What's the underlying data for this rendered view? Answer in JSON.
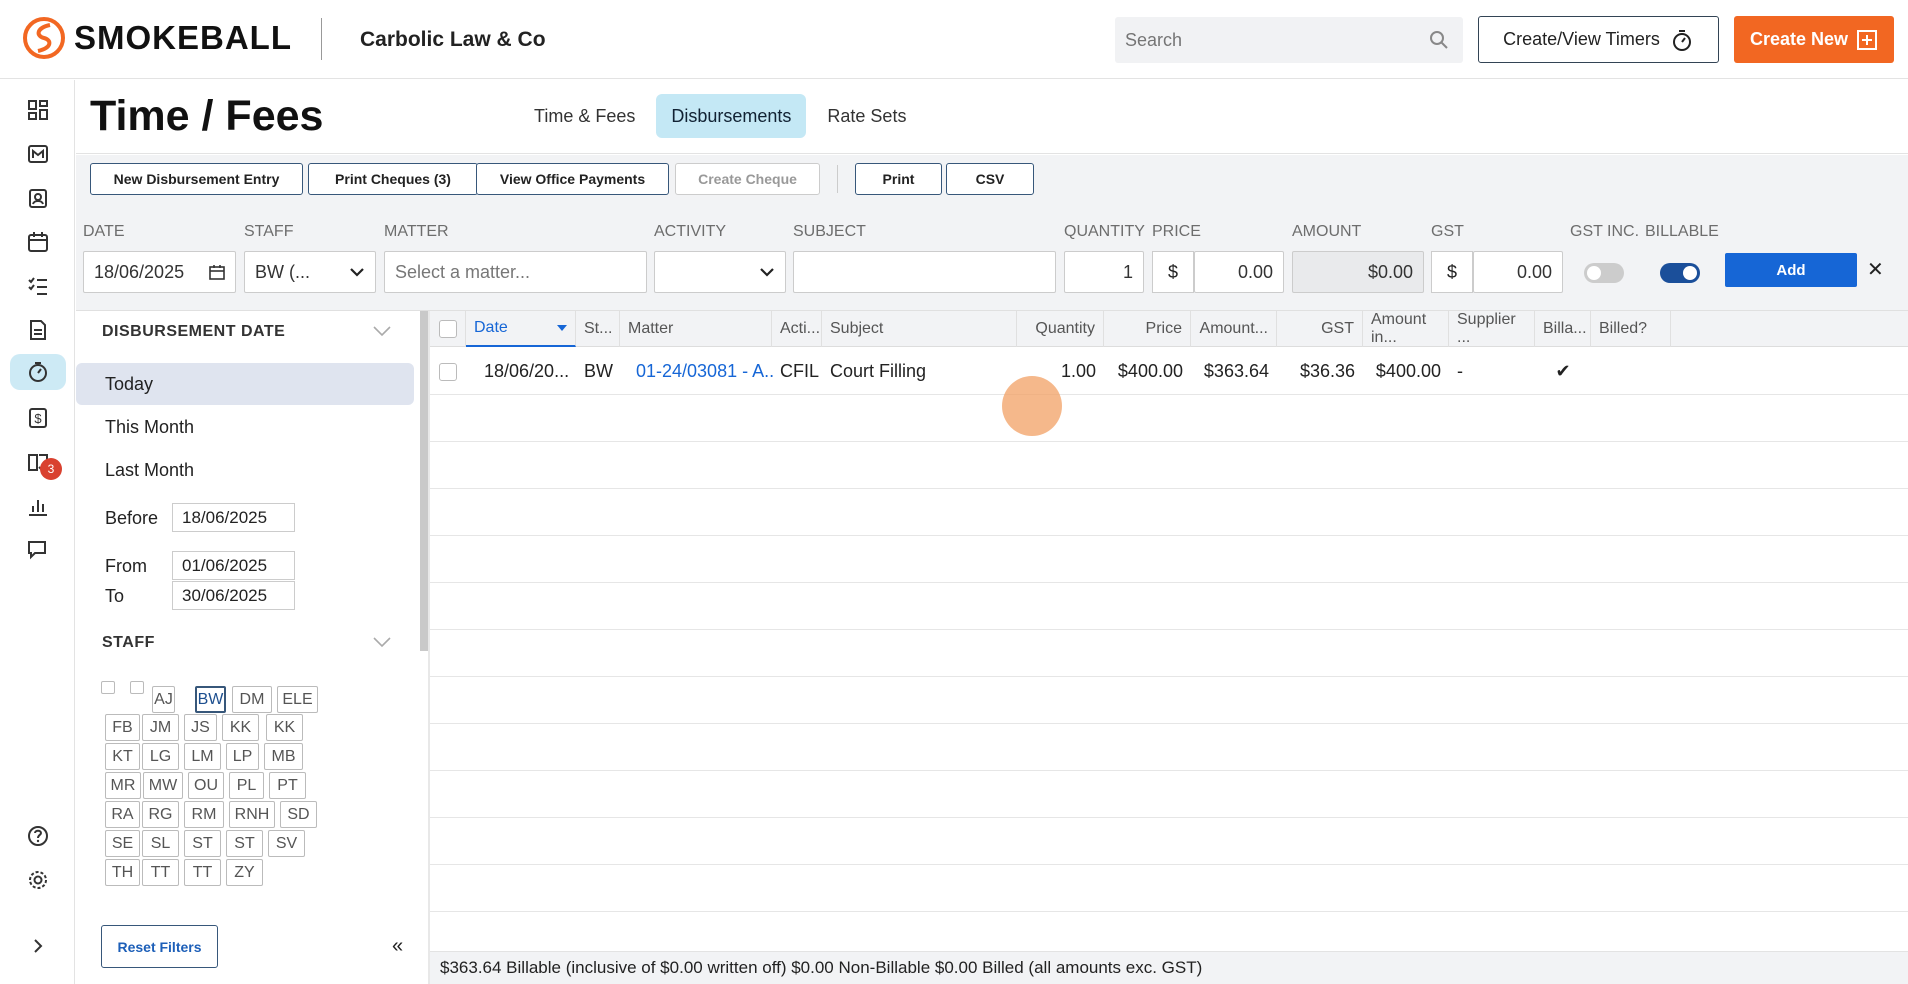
{
  "app": {
    "brand": "SMOKEBALL",
    "firm": "Carbolic Law & Co"
  },
  "header": {
    "search_placeholder": "Search",
    "timers_label": "Create/View Timers",
    "create_label": "Create New"
  },
  "nav": {
    "messages_badge": "3"
  },
  "page": {
    "title": "Time / Fees",
    "tabs": [
      {
        "label": "Time & Fees",
        "active": false
      },
      {
        "label": "Disbursements",
        "active": true
      },
      {
        "label": "Rate Sets",
        "active": false
      }
    ]
  },
  "toolbar": {
    "new_entry": "New Disbursement Entry",
    "print_cheques": "Print Cheques (3)",
    "view_office": "View Office Payments",
    "create_cheque": "Create Cheque",
    "print": "Print",
    "csv": "CSV"
  },
  "entry": {
    "labels": {
      "date": "DATE",
      "staff": "STAFF",
      "matter": "MATTER",
      "activity": "ACTIVITY",
      "subject": "SUBJECT",
      "quantity": "QUANTITY",
      "price": "PRICE",
      "amount": "AMOUNT",
      "gst": "GST",
      "gst_inc": "GST INC.",
      "billable": "BILLABLE"
    },
    "date_value": "18/06/2025",
    "staff_value": "BW (...",
    "matter_placeholder": "Select a matter...",
    "activity_value": "",
    "subject_value": "",
    "quantity_value": "1",
    "currency": "$",
    "price_value": "0.00",
    "amount_value": "$0.00",
    "gst_value": "0.00",
    "gst_inc_on": false,
    "billable_on": true,
    "add_label": "Add",
    "close_glyph": "✕"
  },
  "filters": {
    "date_heading": "DISBURSEMENT DATE",
    "date_items": [
      {
        "label": "Today",
        "active": true
      },
      {
        "label": "This Month",
        "active": false
      },
      {
        "label": "Last Month",
        "active": false
      }
    ],
    "before_label": "Before",
    "before_value": "18/06/2025",
    "from_label": "From",
    "from_value": "01/06/2025",
    "to_label": "To",
    "to_value": "30/06/2025",
    "staff_heading": "STAFF",
    "staff_chips": [
      "",
      "",
      "AJ",
      "BW",
      "DM",
      "ELE",
      "FB",
      "JM",
      "JS",
      "KK",
      "KK",
      "KT",
      "LG",
      "LM",
      "LP",
      "MB",
      "MR",
      "MW",
      "OU",
      "PL",
      "PT",
      "RA",
      "RG",
      "RM",
      "RNH",
      "SD",
      "SE",
      "SL",
      "ST",
      "ST",
      "SV",
      "TH",
      "TT",
      "TT",
      "ZY"
    ],
    "selected_chip": "BW",
    "reset_label": "Reset Filters",
    "collapse_glyph": "«"
  },
  "grid": {
    "columns": [
      "Date",
      "St...",
      "Matter",
      "Acti...",
      "Subject",
      "Quantity",
      "Price",
      "Amount...",
      "GST",
      "Amount in...",
      "Supplier ...",
      "Billa...",
      "Billed?"
    ],
    "rows": [
      {
        "date": "18/06/20...",
        "staff": "BW",
        "matter": "01-24/03081 - A...",
        "activity": "CFIL",
        "subject": "Court Filling",
        "quantity": "1.00",
        "price": "$400.00",
        "amount": "$363.64",
        "gst": "$36.36",
        "amount_inc": "$400.00",
        "supplier": "-",
        "billable": "✔",
        "billed": ""
      }
    ]
  },
  "footer": {
    "summary": "$363.64 Billable (inclusive of $0.00 written off)  $0.00 Non-Billable  $0.00 Billed  (all amounts exc. GST)"
  },
  "colors": {
    "accent": "#f26722",
    "primary": "#1666d6",
    "active_tab": "#c4e8f5"
  }
}
